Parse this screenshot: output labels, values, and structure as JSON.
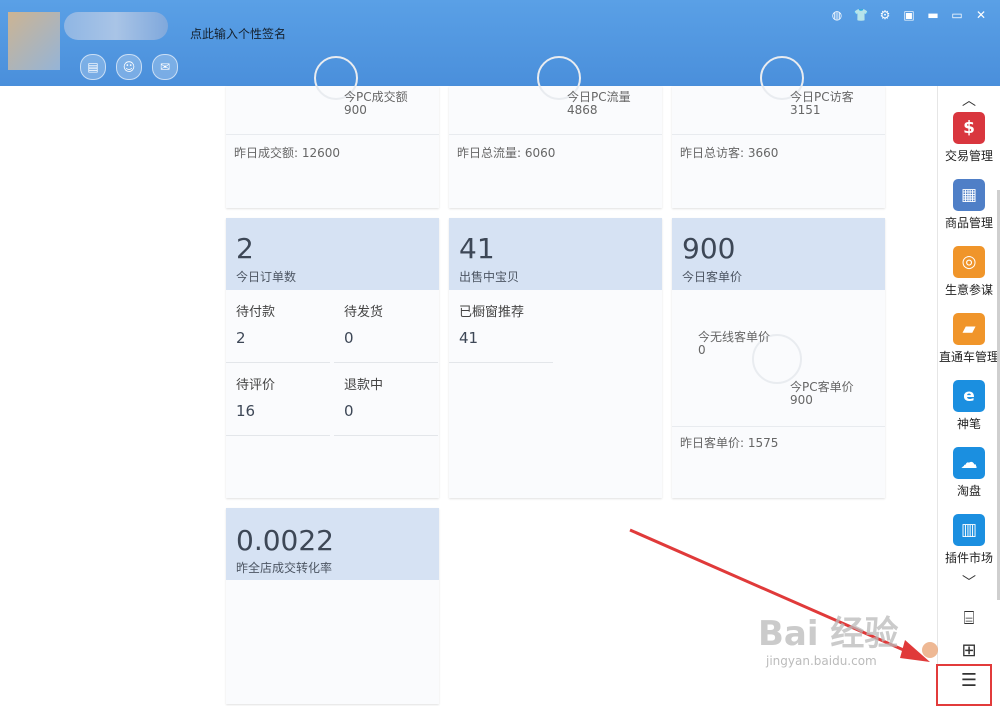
{
  "header": {
    "signature": "点此输入个性签名",
    "icons": [
      "card-icon",
      "baby-icon",
      "mail-icon"
    ],
    "window_controls": [
      "skin-icon",
      "shirt-icon",
      "gear-icon",
      "menu-icon",
      "minimize-icon",
      "maximize-icon",
      "close-icon"
    ]
  },
  "cards_row1": [
    {
      "top_label": "今PC成交额",
      "top_value": "900",
      "bottom": "昨日成交额: 12600"
    },
    {
      "top_label": "今日PC流量",
      "top_value": "4868",
      "bottom": "昨日总流量: 6060"
    },
    {
      "top_label": "今日PC访客",
      "top_value": "3151",
      "bottom": "昨日总访客: 3660"
    }
  ],
  "orders": {
    "value": "2",
    "label": "今日订单数",
    "cells": [
      {
        "label": "待付款",
        "value": "2"
      },
      {
        "label": "待发货",
        "value": "0"
      },
      {
        "label": "待评价",
        "value": "16"
      },
      {
        "label": "退款中",
        "value": "0"
      }
    ]
  },
  "selling": {
    "value": "41",
    "label": "出售中宝贝",
    "cells": [
      {
        "label": "已橱窗推荐",
        "value": "41"
      }
    ]
  },
  "price": {
    "value": "900",
    "label": "今日客单价",
    "wireless_label": "今无线客单价",
    "wireless_value": "0",
    "pc_label": "今PC客单价",
    "pc_value": "900",
    "bottom": "昨日客单价: 1575"
  },
  "conversion": {
    "value": "0.0022",
    "label": "昨全店成交转化率"
  },
  "sidebar": {
    "tools": [
      {
        "label": "交易管理",
        "icon": "dollar-icon",
        "color": "#d9363e",
        "glyph": "$"
      },
      {
        "label": "商品管理",
        "icon": "goods-icon",
        "color": "#4f7fc7",
        "glyph": "▦"
      },
      {
        "label": "生意参谋",
        "icon": "compass-icon",
        "color": "#f0952a",
        "glyph": "◎"
      },
      {
        "label": "直通车管理",
        "icon": "car-icon",
        "color": "#f0952a",
        "glyph": "▰"
      },
      {
        "label": "神笔",
        "icon": "pen-icon",
        "color": "#1b8fe0",
        "glyph": "e"
      },
      {
        "label": "淘盘",
        "icon": "cloud-icon",
        "color": "#1b8fe0",
        "glyph": "☁"
      },
      {
        "label": "插件市场",
        "icon": "store-icon",
        "color": "#1b8fe0",
        "glyph": "▥"
      }
    ]
  },
  "watermark": {
    "text": "Bai 经验",
    "url": "jingyan.baidu.com"
  },
  "colors": {
    "header": "#4a8fdb",
    "card_top": "#d6e2f3",
    "highlight": "#e23b3b",
    "arrow": "#e03a3a"
  }
}
